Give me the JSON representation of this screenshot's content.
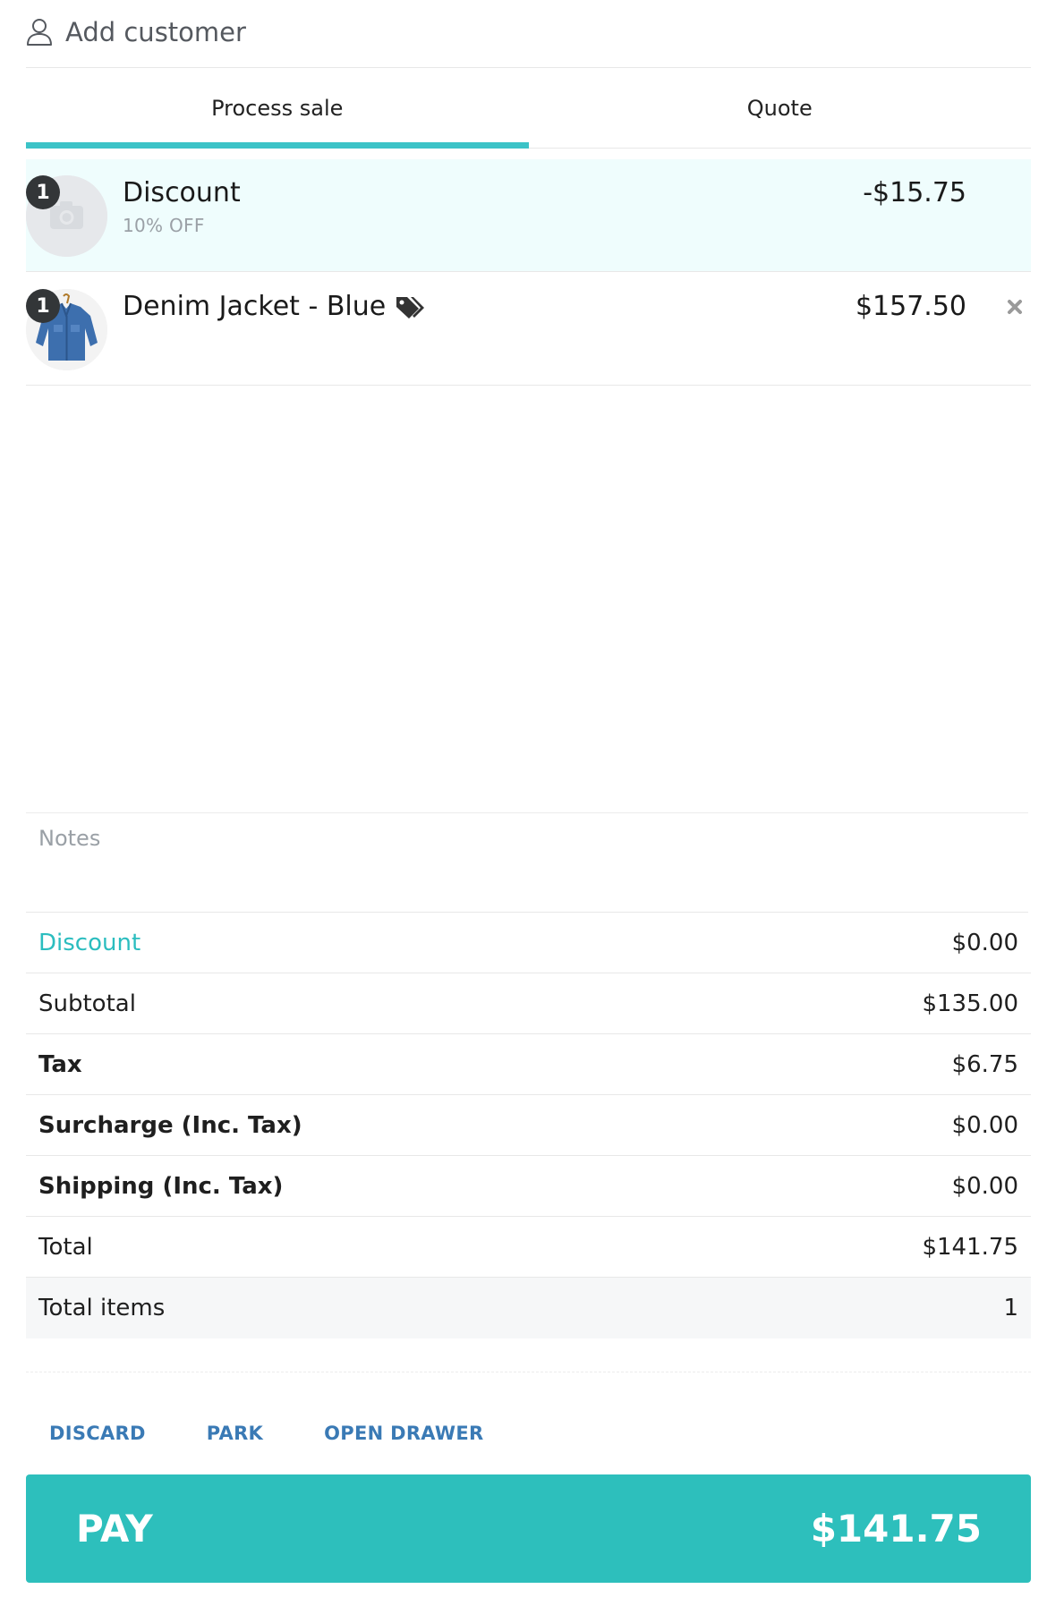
{
  "customer": {
    "label": "Add customer"
  },
  "tabs": [
    {
      "label": "Process sale",
      "active": true
    },
    {
      "label": "Quote",
      "active": false
    }
  ],
  "cart": {
    "items": [
      {
        "qty": "1",
        "name": "Discount",
        "subtitle": "10% OFF",
        "price": "-$15.75",
        "image": "camera-placeholder-icon"
      },
      {
        "qty": "1",
        "name": "Denim Jacket - Blue",
        "price": "$157.50",
        "image": "denim-jacket-photo",
        "has_tag": true
      }
    ]
  },
  "notes": {
    "placeholder": "Notes"
  },
  "summary": {
    "rows": [
      {
        "label": "Discount",
        "value": "$0.00"
      },
      {
        "label": "Subtotal",
        "value": "$135.00"
      },
      {
        "label": "Tax",
        "value": "$6.75"
      },
      {
        "label": "Surcharge (Inc. Tax)",
        "value": "$0.00"
      },
      {
        "label": "Shipping (Inc. Tax)",
        "value": "$0.00"
      },
      {
        "label": "Total",
        "value": "$141.75"
      },
      {
        "label": "Total items",
        "value": "1"
      }
    ]
  },
  "actions": {
    "discard": "DISCARD",
    "park": "PARK",
    "open_drawer": "OPEN DRAWER"
  },
  "pay": {
    "label": "PAY",
    "amount": "$141.75"
  },
  "colors": {
    "accent": "#2dbfbc",
    "link": "#3a7ab5",
    "highlight_row": "#effdfd"
  }
}
